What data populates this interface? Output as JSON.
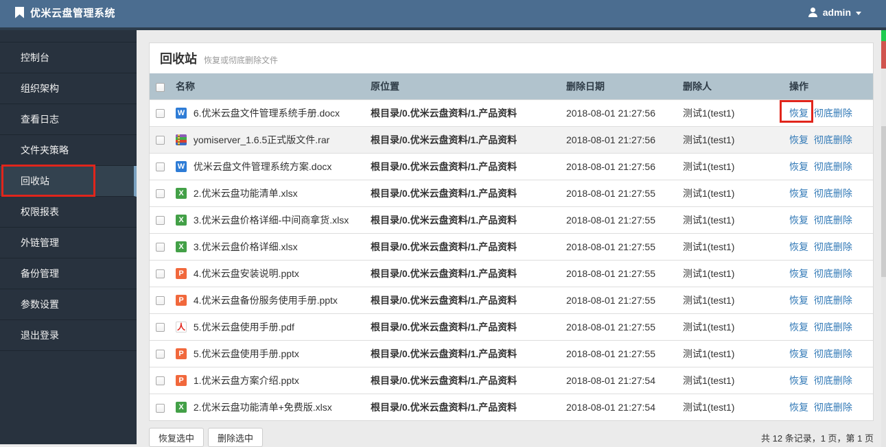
{
  "app": {
    "title": "优米云盘管理系统",
    "user": "admin"
  },
  "sidebar": {
    "active_index": 4,
    "items": [
      {
        "label": "控制台"
      },
      {
        "label": "组织架构"
      },
      {
        "label": "查看日志"
      },
      {
        "label": "文件夹策略"
      },
      {
        "label": "回收站"
      },
      {
        "label": "权限报表"
      },
      {
        "label": "外链管理"
      },
      {
        "label": "备份管理"
      },
      {
        "label": "参数设置"
      },
      {
        "label": "退出登录"
      }
    ]
  },
  "page": {
    "title": "回收站",
    "subtitle": "恢复或彻底删除文件"
  },
  "table": {
    "headers": [
      "名称",
      "原位置",
      "删除日期",
      "删除人",
      "操作"
    ],
    "icon_glyphs": {
      "docx": "W",
      "xlsx": "X",
      "pptx": "P",
      "pdf": "人",
      "rar": ""
    },
    "action_restore": "恢复",
    "action_delete": "彻底删除",
    "rows": [
      {
        "type": "docx",
        "name": "6.优米云盘文件管理系统手册.docx",
        "location": "根目录/0.优米云盘资料/1.产品资料",
        "date": "2018-08-01 21:27:56",
        "deleter": "测试1(test1)",
        "highlighted": false
      },
      {
        "type": "rar",
        "name": "yomiserver_1.6.5正式版文件.rar",
        "location": "根目录/0.优米云盘资料/1.产品资料",
        "date": "2018-08-01 21:27:56",
        "deleter": "测试1(test1)",
        "highlighted": true
      },
      {
        "type": "docx",
        "name": "优米云盘文件管理系统方案.docx",
        "location": "根目录/0.优米云盘资料/1.产品资料",
        "date": "2018-08-01 21:27:56",
        "deleter": "测试1(test1)",
        "highlighted": false
      },
      {
        "type": "xlsx",
        "name": "2.优米云盘功能清单.xlsx",
        "location": "根目录/0.优米云盘资料/1.产品资料",
        "date": "2018-08-01 21:27:55",
        "deleter": "测试1(test1)",
        "highlighted": false
      },
      {
        "type": "xlsx",
        "name": "3.优米云盘价格详细-中间商拿货.xlsx",
        "location": "根目录/0.优米云盘资料/1.产品资料",
        "date": "2018-08-01 21:27:55",
        "deleter": "测试1(test1)",
        "highlighted": false
      },
      {
        "type": "xlsx",
        "name": "3.优米云盘价格详细.xlsx",
        "location": "根目录/0.优米云盘资料/1.产品资料",
        "date": "2018-08-01 21:27:55",
        "deleter": "测试1(test1)",
        "highlighted": false
      },
      {
        "type": "pptx",
        "name": "4.优米云盘安装说明.pptx",
        "location": "根目录/0.优米云盘资料/1.产品资料",
        "date": "2018-08-01 21:27:55",
        "deleter": "测试1(test1)",
        "highlighted": false
      },
      {
        "type": "pptx",
        "name": "4.优米云盘备份服务使用手册.pptx",
        "location": "根目录/0.优米云盘资料/1.产品资料",
        "date": "2018-08-01 21:27:55",
        "deleter": "测试1(test1)",
        "highlighted": false
      },
      {
        "type": "pdf",
        "name": "5.优米云盘使用手册.pdf",
        "location": "根目录/0.优米云盘资料/1.产品资料",
        "date": "2018-08-01 21:27:55",
        "deleter": "测试1(test1)",
        "highlighted": false
      },
      {
        "type": "pptx",
        "name": "5.优米云盘使用手册.pptx",
        "location": "根目录/0.优米云盘资料/1.产品资料",
        "date": "2018-08-01 21:27:55",
        "deleter": "测试1(test1)",
        "highlighted": false
      },
      {
        "type": "pptx",
        "name": "1.优米云盘方案介绍.pptx",
        "location": "根目录/0.优米云盘资料/1.产品资料",
        "date": "2018-08-01 21:27:54",
        "deleter": "测试1(test1)",
        "highlighted": false
      },
      {
        "type": "xlsx",
        "name": "2.优米云盘功能清单+免费版.xlsx",
        "location": "根目录/0.优米云盘资料/1.产品资料",
        "date": "2018-08-01 21:27:54",
        "deleter": "测试1(test1)",
        "highlighted": false
      }
    ]
  },
  "footer": {
    "restore_selected": "恢复选中",
    "delete_selected": "删除选中",
    "summary": "共 12 条记录，1 页，第 1 页"
  },
  "colors": {
    "topbar": "#4b6d90",
    "sidebar": "#28323e",
    "table_header": "#b1c3cd",
    "link": "#337ab7",
    "annotation": "#e1251b"
  }
}
